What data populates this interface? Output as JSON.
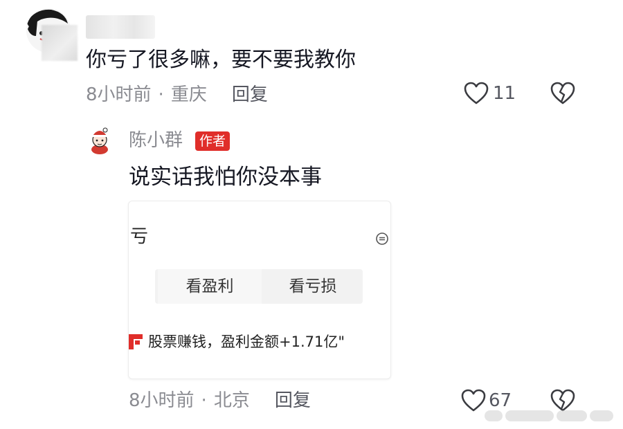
{
  "comment": {
    "text": "你亏了很多嘛，要不要我教你",
    "time": "8小时前",
    "location": "重庆",
    "reply_label": "回复",
    "like_count": "11",
    "like_icon": "heart-outline-icon",
    "dislike_icon": "broken-heart-icon"
  },
  "reply": {
    "author_name": "陈小群",
    "author_badge": "作者",
    "text": "说实话我怕你没本事",
    "time": "8小时前",
    "location": "北京",
    "reply_label": "回复",
    "like_count": "67",
    "embedded_card": {
      "corner_text": "亏",
      "tabs": [
        "看盈利",
        "看亏损"
      ],
      "headline": "股票赚钱，盈利金额+1.71亿\""
    }
  },
  "colors": {
    "badge": "#e02e2a",
    "meta": "#8a8b91",
    "text": "#161823"
  }
}
